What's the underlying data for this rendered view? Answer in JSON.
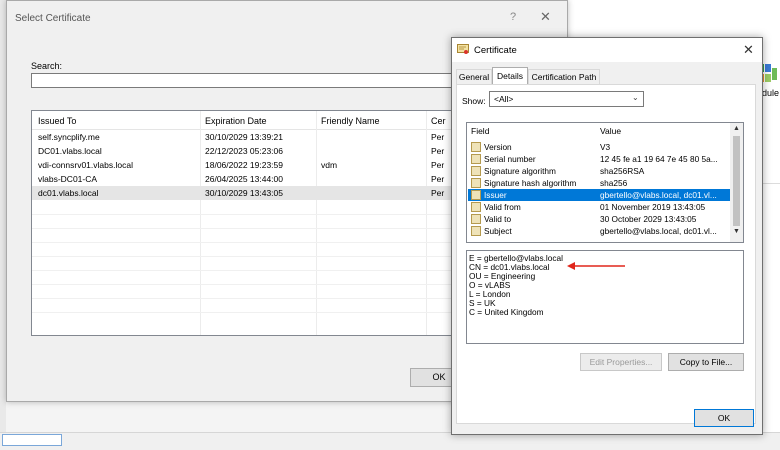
{
  "select_dialog": {
    "title": "Select Certificate",
    "help_glyph": "?",
    "close_glyph": "✕",
    "search_label": "Search:",
    "search_value": "",
    "columns": [
      "Issued To",
      "Expiration Date",
      "Friendly Name",
      "Cer"
    ],
    "rows": [
      {
        "issued_to": "self.syncplify.me",
        "expiration": "30/10/2029 13:39:21",
        "friendly": "",
        "cert": "Per"
      },
      {
        "issued_to": "DC01.vlabs.local",
        "expiration": "22/12/2023 05:23:06",
        "friendly": "",
        "cert": "Per"
      },
      {
        "issued_to": "vdi-connsrv01.vlabs.local",
        "expiration": "18/06/2022 19:23:59",
        "friendly": "vdm",
        "cert": "Per"
      },
      {
        "issued_to": "vlabs-DC01-CA",
        "expiration": "26/04/2025 13:44:00",
        "friendly": "",
        "cert": "Per"
      },
      {
        "issued_to": "dc01.vlabs.local",
        "expiration": "30/10/2029 13:43:05",
        "friendly": "",
        "cert": "Per"
      }
    ],
    "ok_label": "OK"
  },
  "cert_dialog": {
    "title": "Certificate",
    "close_glyph": "✕",
    "tabs": [
      "General",
      "Details",
      "Certification Path"
    ],
    "active_tab": "Details",
    "show_label": "Show:",
    "show_value": "<All>",
    "field_header": "Field",
    "value_header": "Value",
    "fields": [
      {
        "name": "Version",
        "value": "V3"
      },
      {
        "name": "Serial number",
        "value": "12 45 fe a1 19 64 7e 45 80 5a..."
      },
      {
        "name": "Signature algorithm",
        "value": "sha256RSA"
      },
      {
        "name": "Signature hash algorithm",
        "value": "sha256"
      },
      {
        "name": "Issuer",
        "value": "gbertello@vlabs.local, dc01.vl..."
      },
      {
        "name": "Valid from",
        "value": "01 November 2019 13:43:05"
      },
      {
        "name": "Valid to",
        "value": "30 October 2029 13:43:05"
      },
      {
        "name": "Subject",
        "value": "gbertello@vlabs.local, dc01.vl..."
      }
    ],
    "selected_field": "Issuer",
    "detail_lines": [
      "E = gbertello@vlabs.local",
      "CN = dc01.vlabs.local",
      "OU = Engineering",
      "O = vLABS",
      "L = London",
      "S = UK",
      "C = United Kingdom"
    ],
    "edit_properties_label": "Edit Properties...",
    "copy_to_file_label": "Copy to File...",
    "ok_label": "OK",
    "annotation_arrow_color": "#e0261b"
  },
  "background": {
    "partial_label": "odule"
  }
}
